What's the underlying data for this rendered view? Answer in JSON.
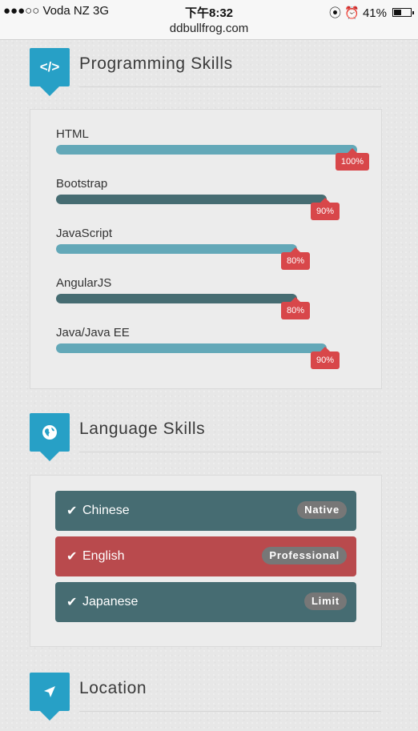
{
  "status_bar": {
    "carrier": "●●●○○ Voda NZ  3G",
    "time": "下午8:32",
    "icons": "⦿ ⏰ 41%",
    "url": "ddbullfrog.com"
  },
  "sections": {
    "programming": {
      "title": "Programming Skills",
      "icon": "code-icon"
    },
    "language": {
      "title": "Language Skills",
      "icon": "globe-icon"
    },
    "location": {
      "title": "Location",
      "icon": "location-arrow-icon"
    }
  },
  "programming_skills": [
    {
      "name": "HTML",
      "percent_label": "100%",
      "level": 1.0,
      "color": "#63a8b8"
    },
    {
      "name": "Bootstrap",
      "percent_label": "90%",
      "level": 0.9,
      "color": "#466c72"
    },
    {
      "name": "JavaScript",
      "percent_label": "80%",
      "level": 0.8,
      "color": "#63a8b8"
    },
    {
      "name": "AngularJS",
      "percent_label": "80%",
      "level": 0.8,
      "color": "#466c72"
    },
    {
      "name": "Java/Java EE",
      "percent_label": "90%",
      "level": 0.9,
      "color": "#63a8b8"
    }
  ],
  "language_skills": [
    {
      "name": "Chinese",
      "level": "Native",
      "color": "#466c72"
    },
    {
      "name": "English",
      "level": "Professional",
      "color": "#b94a4d"
    },
    {
      "name": "Japanese",
      "level": "Limit",
      "color": "#466c72"
    }
  ],
  "colors": {
    "accent": "#27a0c6",
    "badge_red": "#d8474a"
  }
}
